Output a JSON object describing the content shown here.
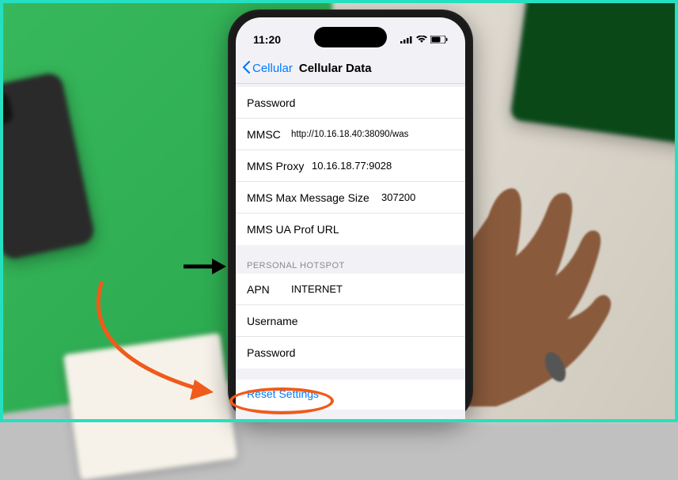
{
  "status": {
    "time": "11:20"
  },
  "nav": {
    "back_label": "Cellular",
    "title": "Cellular Data"
  },
  "mms": {
    "password_label": "Password",
    "password_value": "",
    "mmsc_label": "MMSC",
    "mmsc_value": "http://10.16.18.40:38090/was",
    "proxy_label": "MMS Proxy",
    "proxy_value": "10.16.18.77:9028",
    "maxsize_label": "MMS Max Message Size",
    "maxsize_value": "307200",
    "uaprof_label": "MMS UA Prof URL",
    "uaprof_value": ""
  },
  "hotspot": {
    "section_title": "PERSONAL HOTSPOT",
    "apn_label": "APN",
    "apn_value": "INTERNET",
    "username_label": "Username",
    "username_value": "",
    "password_label": "Password",
    "password_value": ""
  },
  "reset_label": "Reset Settings"
}
